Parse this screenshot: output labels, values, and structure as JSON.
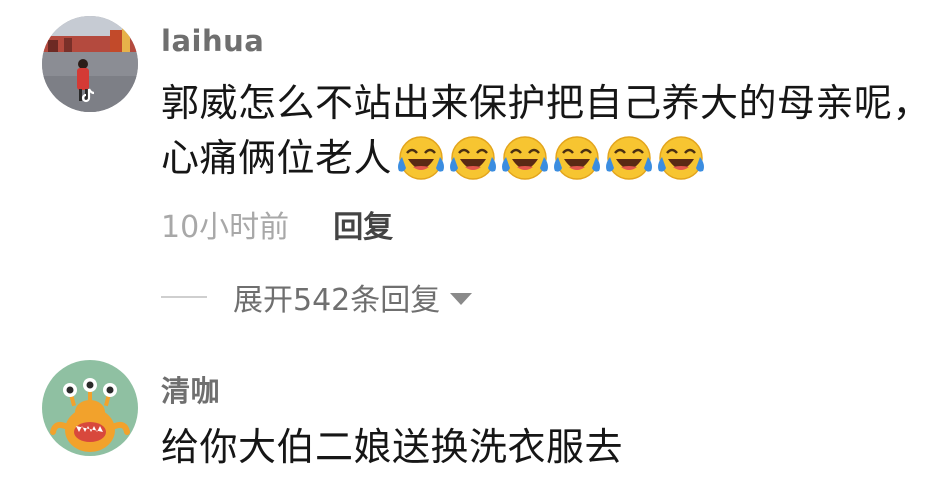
{
  "comments": [
    {
      "username": "laihua",
      "avatar_icon": "tiktok-photo-avatar",
      "line1": "郭威怎么不站出来保护把自己养大的母亲呢，",
      "line2": "心痛俩位老人",
      "emoji_icon": "laughing-tears-emoji",
      "emoji_count": 6,
      "time": "10小时前",
      "reply_label": "回复",
      "expand_label": "展开542条回复"
    },
    {
      "username": "清咖",
      "avatar_icon": "green-monster-avatar",
      "line1": "给你大伯二娘送换洗衣服去"
    }
  ],
  "colors": {
    "username": "#6f6f6f",
    "body_text": "#161616",
    "timestamp": "#a8a8a8",
    "reply": "#444444",
    "avatar2_bg": "#8fc0a2",
    "monster": "#f2a22c",
    "emoji_face": "#f7c531",
    "emoji_tears": "#3b8de0"
  }
}
